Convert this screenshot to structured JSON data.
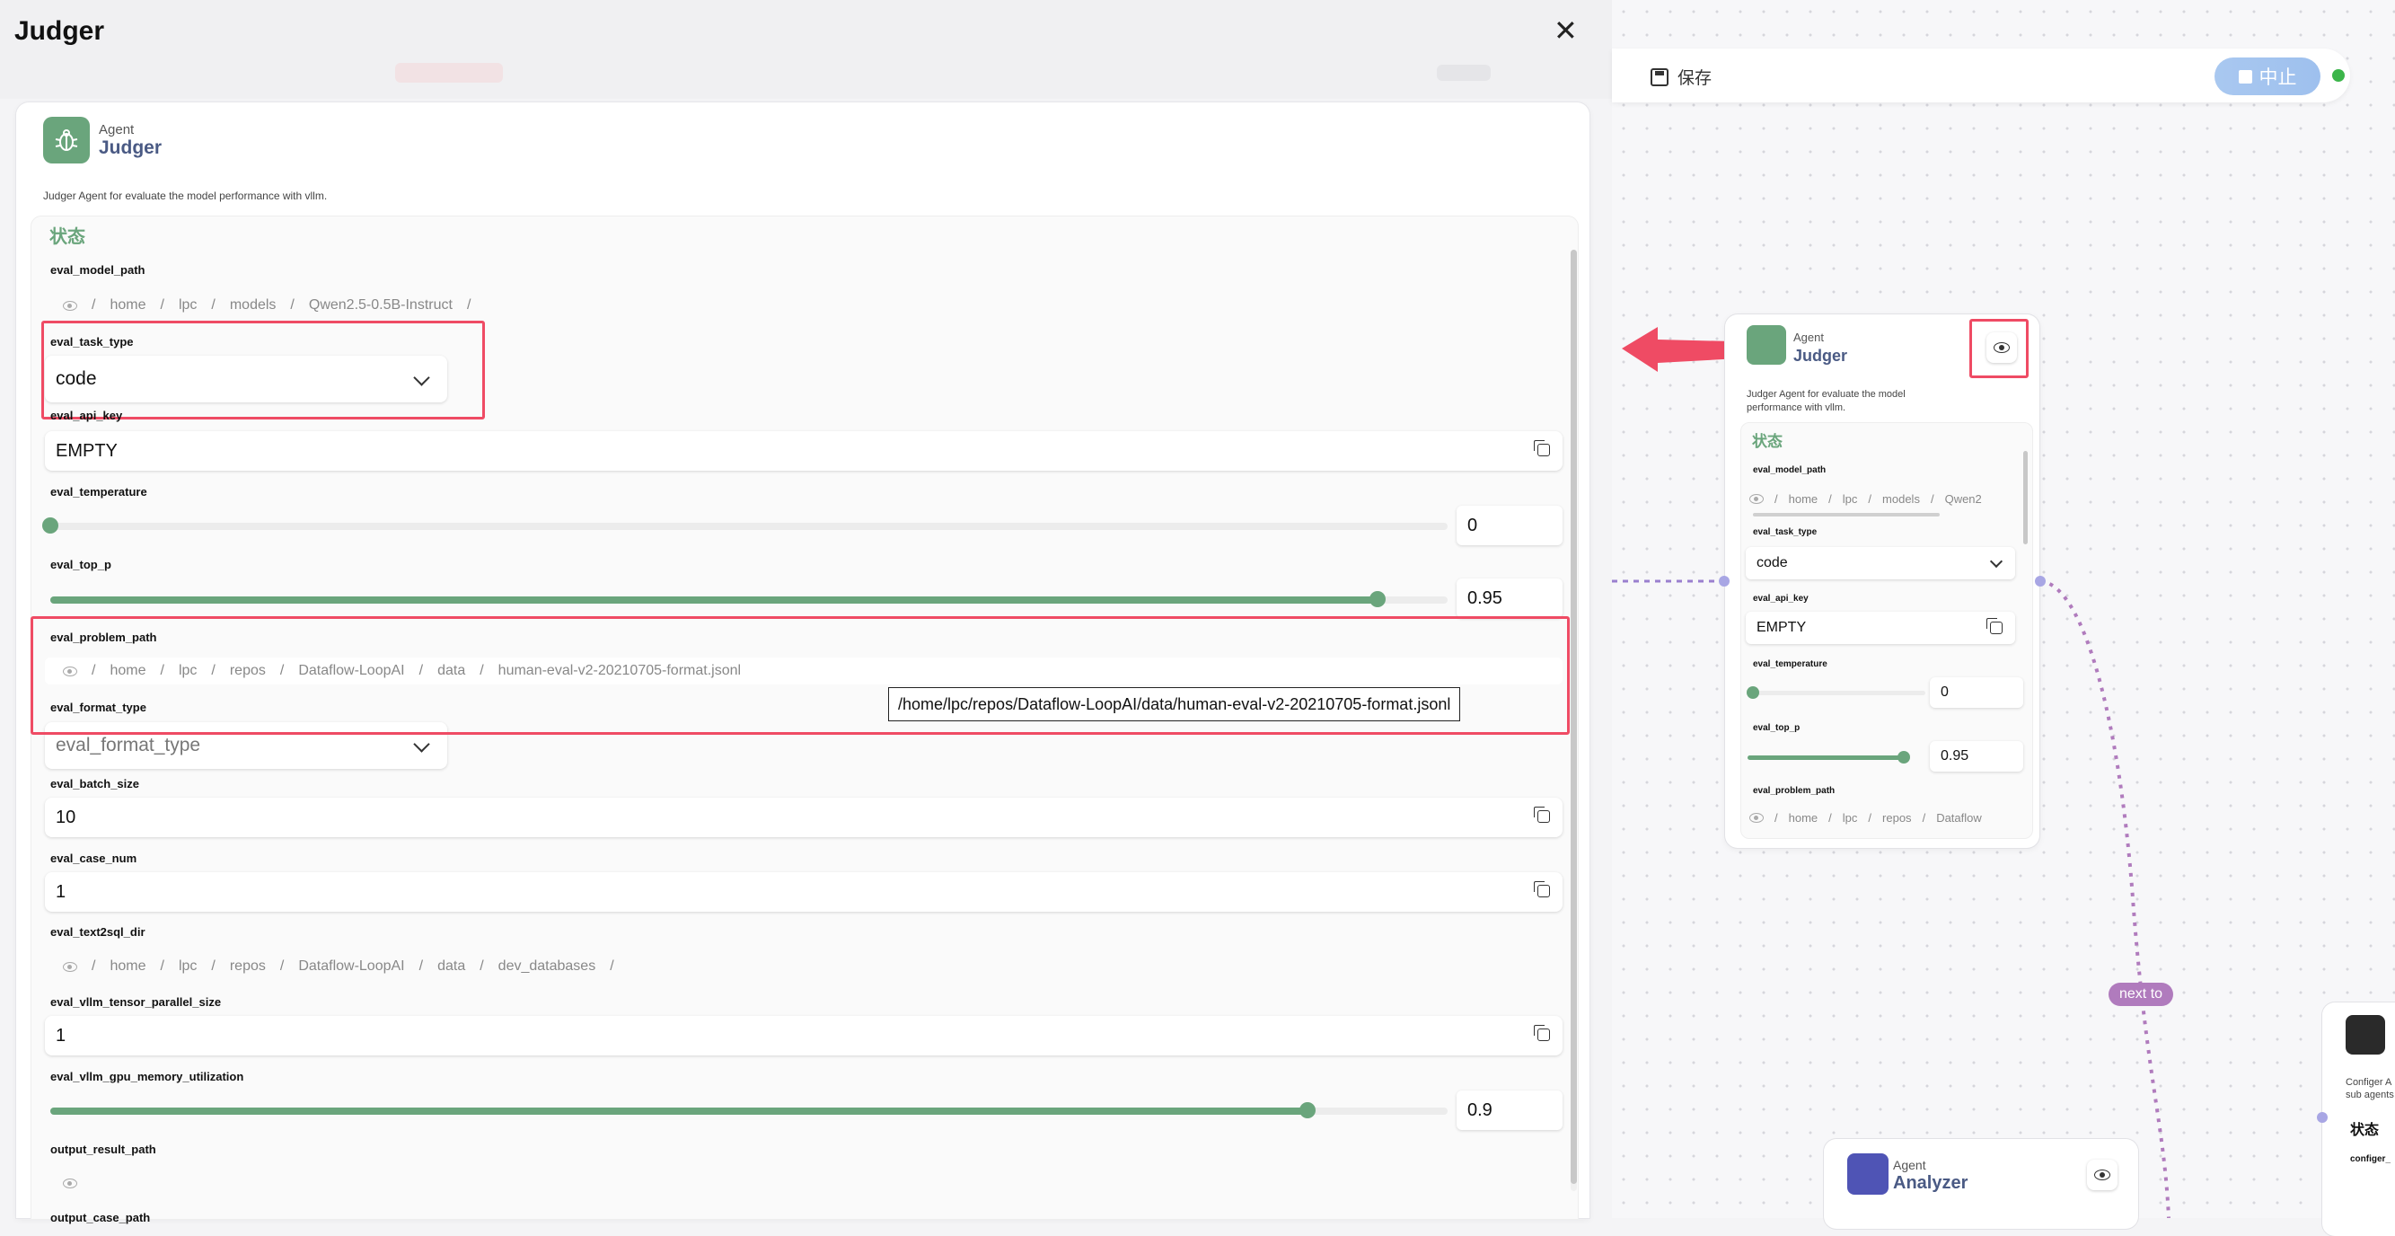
{
  "modal": {
    "title": "Judger",
    "agent_kind": "Agent",
    "agent_name": "Judger",
    "description": "Judger Agent for evaluate the model performance with vllm.",
    "state_title": "状态",
    "fields": {
      "eval_model_path": {
        "label": "eval_model_path",
        "segments": [
          "home",
          "lpc",
          "models",
          "Qwen2.5-0.5B-Instruct",
          ""
        ]
      },
      "eval_task_type": {
        "label": "eval_task_type",
        "value": "code"
      },
      "eval_api_key": {
        "label": "eval_api_key",
        "value": "EMPTY"
      },
      "eval_temperature": {
        "label": "eval_temperature",
        "value": "0",
        "level": 0
      },
      "eval_top_p": {
        "label": "eval_top_p",
        "value": "0.95",
        "level": 0.95
      },
      "eval_problem_path": {
        "label": "eval_problem_path",
        "segments": [
          "home",
          "lpc",
          "repos",
          "Dataflow-LoopAI",
          "data",
          "human-eval-v2-20210705-format.jsonl"
        ]
      },
      "eval_format_type": {
        "label": "eval_format_type",
        "placeholder": "eval_format_type"
      },
      "eval_batch_size": {
        "label": "eval_batch_size",
        "value": "10"
      },
      "eval_case_num": {
        "label": "eval_case_num",
        "value": "1"
      },
      "eval_text2sql_dir": {
        "label": "eval_text2sql_dir",
        "segments": [
          "home",
          "lpc",
          "repos",
          "Dataflow-LoopAI",
          "data",
          "dev_databases",
          ""
        ]
      },
      "eval_vllm_tensor_parallel_size": {
        "label": "eval_vllm_tensor_parallel_size",
        "value": "1"
      },
      "eval_vllm_gpu_memory_utilization": {
        "label": "eval_vllm_gpu_memory_utilization",
        "value": "0.9",
        "level": 0.9
      },
      "output_result_path": {
        "label": "output_result_path"
      },
      "output_case_path": {
        "label": "output_case_path"
      }
    },
    "tooltip": "/home/lpc/repos/Dataflow-LoopAI/data/human-eval-v2-20210705-format.jsonl"
  },
  "toolbar": {
    "save_label": "保存",
    "stop_label": "中止"
  },
  "node": {
    "agent_kind": "Agent",
    "agent_name": "Judger",
    "description_line1": "Judger Agent for evaluate the model",
    "description_line2": "performance with vllm.",
    "state_title": "状态",
    "model_path_segments": [
      "home",
      "lpc",
      "models",
      "Qwen2"
    ],
    "task_type": "code",
    "api_key": "EMPTY",
    "temperature": "0",
    "top_p": "0.95",
    "problem_path_segments": [
      "home",
      "lpc",
      "repos",
      "Dataflow"
    ]
  },
  "edge_label": "next to",
  "analyzer": {
    "agent_kind": "Agent",
    "agent_name": "Analyzer"
  },
  "configer": {
    "description_fragment1": "Configer A",
    "description_fragment2": "sub agents",
    "state_title": "状态",
    "field_fragment": "configer_"
  },
  "colors": {
    "accent": "#6aa57c",
    "highlight": "#ef4b64",
    "edge": "#b07bbd",
    "stop": "#9ec0ee"
  }
}
